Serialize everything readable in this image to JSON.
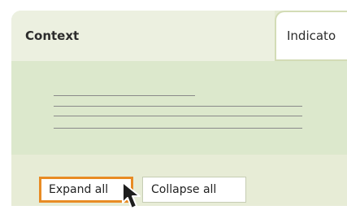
{
  "tabs": [
    {
      "label": "Context",
      "active": true
    },
    {
      "label": "Indicato",
      "active": false
    }
  ],
  "actions": {
    "expand_label": "Expand all",
    "collapse_label": "Collapse all"
  },
  "colors": {
    "highlight": "#e88b24",
    "panel_background": "#e5ebd4",
    "content_background": "#dce8cc"
  },
  "icons": {
    "cursor": "arrow-cursor-icon"
  }
}
